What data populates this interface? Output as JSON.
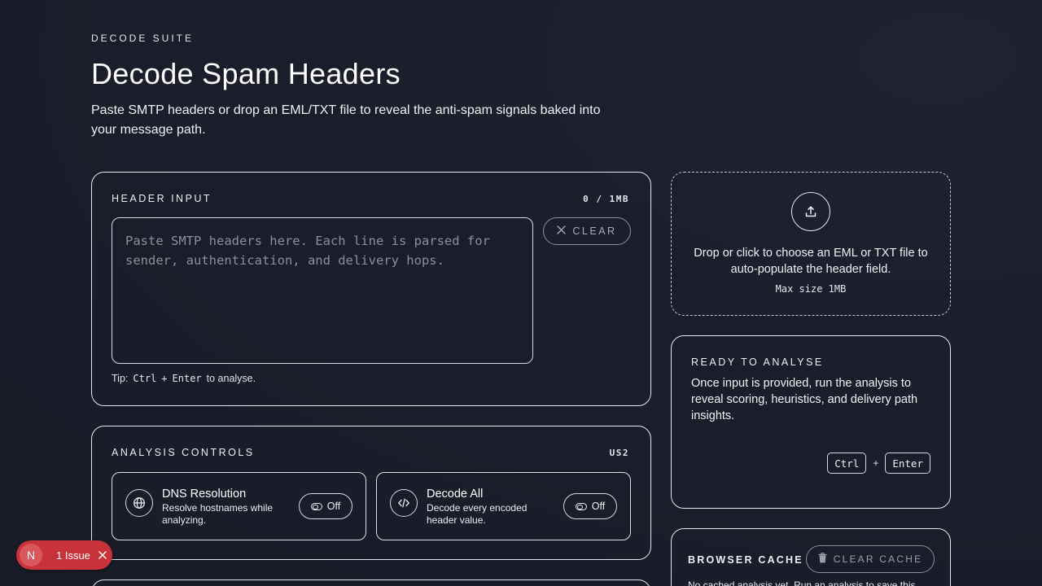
{
  "header": {
    "eyebrow": "DECODE SUITE",
    "title": "Decode Spam Headers",
    "subtitle": "Paste SMTP headers or drop an EML/TXT file to reveal the anti-spam signals baked into your message path."
  },
  "header_input": {
    "label": "HEADER INPUT",
    "size_meta": "0 / 1MB",
    "placeholder": "Paste SMTP headers here. Each line is parsed for sender, authentication, and delivery hops.",
    "value": "",
    "clear_label": "CLEAR",
    "tip_prefix": "Tip:",
    "tip_key1": "Ctrl",
    "tip_plus": "+",
    "tip_key2": "Enter",
    "tip_suffix": "to analyse."
  },
  "analysis_controls": {
    "label": "ANALYSIS CONTROLS",
    "region": "US2",
    "toggles": [
      {
        "icon": "globe-icon",
        "title": "DNS Resolution",
        "description": "Resolve hostnames while analyzing.",
        "state": "Off"
      },
      {
        "icon": "code-icon",
        "title": "Decode All",
        "description": "Decode every encoded header value.",
        "state": "Off"
      }
    ]
  },
  "dropzone": {
    "icon": "upload-icon",
    "text": "Drop or click to choose an EML or TXT file to auto-populate the header field.",
    "max_size": "Max size 1MB"
  },
  "ready": {
    "label": "READY TO ANALYSE",
    "text": "Once input is provided, run the analysis to reveal scoring, heuristics, and delivery path insights.",
    "key1": "Ctrl",
    "plus": "+",
    "key2": "Enter"
  },
  "browser_cache": {
    "label": "BROWSER CACHE",
    "clear_label": "CLEAR CACHE",
    "text": "No cached analysis yet. Run an analysis to save this"
  },
  "issue_badge": {
    "logo": "N",
    "label": "1 Issue"
  },
  "colors": {
    "background": "#1c1e2b",
    "border": "#e6e6ee",
    "issue_red": "#c8323a"
  }
}
